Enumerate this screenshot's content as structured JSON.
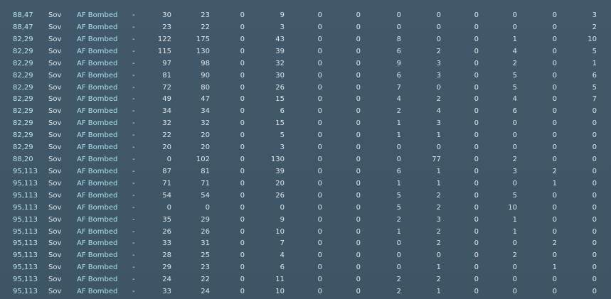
{
  "table": {
    "rows": [
      {
        "coord": "88,47",
        "side": "Sov",
        "type": "AF Bombed",
        "dash": "-",
        "values": [
          "30",
          "23",
          "0",
          "9",
          "0",
          "0",
          "0",
          "0",
          "0",
          "0",
          "0",
          "3"
        ]
      },
      {
        "coord": "88,47",
        "side": "Sov",
        "type": "AF Bombed",
        "dash": "-",
        "values": [
          "23",
          "22",
          "0",
          "3",
          "0",
          "0",
          "0",
          "0",
          "0",
          "0",
          "0",
          "2"
        ]
      },
      {
        "coord": "82,29",
        "side": "Sov",
        "type": "AF Bombed",
        "dash": "-",
        "values": [
          "122",
          "175",
          "0",
          "43",
          "0",
          "0",
          "8",
          "0",
          "0",
          "1",
          "0",
          "10"
        ]
      },
      {
        "coord": "82,29",
        "side": "Sov",
        "type": "AF Bombed",
        "dash": "-",
        "values": [
          "115",
          "130",
          "0",
          "39",
          "0",
          "0",
          "6",
          "2",
          "0",
          "4",
          "0",
          "5"
        ]
      },
      {
        "coord": "82,29",
        "side": "Sov",
        "type": "AF Bombed",
        "dash": "-",
        "values": [
          "97",
          "98",
          "0",
          "32",
          "0",
          "0",
          "9",
          "3",
          "0",
          "2",
          "0",
          "1"
        ]
      },
      {
        "coord": "82,29",
        "side": "Sov",
        "type": "AF Bombed",
        "dash": "-",
        "values": [
          "81",
          "90",
          "0",
          "30",
          "0",
          "0",
          "6",
          "3",
          "0",
          "5",
          "0",
          "6"
        ]
      },
      {
        "coord": "82,29",
        "side": "Sov",
        "type": "AF Bombed",
        "dash": "-",
        "values": [
          "72",
          "80",
          "0",
          "26",
          "0",
          "0",
          "7",
          "0",
          "0",
          "5",
          "0",
          "5"
        ]
      },
      {
        "coord": "82,29",
        "side": "Sov",
        "type": "AF Bombed",
        "dash": "-",
        "values": [
          "49",
          "47",
          "0",
          "15",
          "0",
          "0",
          "4",
          "2",
          "0",
          "4",
          "0",
          "7"
        ]
      },
      {
        "coord": "82,29",
        "side": "Sov",
        "type": "AF Bombed",
        "dash": "-",
        "values": [
          "34",
          "34",
          "0",
          "6",
          "0",
          "0",
          "2",
          "4",
          "0",
          "6",
          "0",
          "0"
        ]
      },
      {
        "coord": "82,29",
        "side": "Sov",
        "type": "AF Bombed",
        "dash": "-",
        "values": [
          "32",
          "32",
          "0",
          "15",
          "0",
          "0",
          "1",
          "3",
          "0",
          "0",
          "0",
          "0"
        ]
      },
      {
        "coord": "82,29",
        "side": "Sov",
        "type": "AF Bombed",
        "dash": "-",
        "values": [
          "22",
          "20",
          "0",
          "5",
          "0",
          "0",
          "1",
          "1",
          "0",
          "0",
          "0",
          "0"
        ]
      },
      {
        "coord": "82,29",
        "side": "Sov",
        "type": "AF Bombed",
        "dash": "-",
        "values": [
          "20",
          "20",
          "0",
          "3",
          "0",
          "0",
          "0",
          "0",
          "0",
          "0",
          "0",
          "0"
        ]
      },
      {
        "coord": "88,20",
        "side": "Sov",
        "type": "AF Bombed",
        "dash": "-",
        "values": [
          "0",
          "102",
          "0",
          "130",
          "0",
          "0",
          "0",
          "77",
          "0",
          "2",
          "0",
          "0"
        ]
      },
      {
        "coord": "95,113",
        "side": "Sov",
        "type": "AF Bombed",
        "dash": "-",
        "values": [
          "87",
          "81",
          "0",
          "39",
          "0",
          "0",
          "6",
          "1",
          "0",
          "3",
          "2",
          "0"
        ]
      },
      {
        "coord": "95,113",
        "side": "Sov",
        "type": "AF Bombed",
        "dash": "-",
        "values": [
          "71",
          "71",
          "0",
          "20",
          "0",
          "0",
          "1",
          "1",
          "0",
          "0",
          "1",
          "0"
        ]
      },
      {
        "coord": "95,113",
        "side": "Sov",
        "type": "AF Bombed",
        "dash": "-",
        "values": [
          "54",
          "54",
          "0",
          "26",
          "0",
          "0",
          "5",
          "2",
          "0",
          "5",
          "0",
          "0"
        ]
      },
      {
        "coord": "95,113",
        "side": "Sov",
        "type": "AF Bombed",
        "dash": "-",
        "values": [
          "0",
          "0",
          "0",
          "0",
          "0",
          "0",
          "5",
          "2",
          "0",
          "10",
          "0",
          "0"
        ]
      },
      {
        "coord": "95,113",
        "side": "Sov",
        "type": "AF Bombed",
        "dash": "-",
        "values": [
          "35",
          "29",
          "0",
          "9",
          "0",
          "0",
          "2",
          "3",
          "0",
          "1",
          "0",
          "0"
        ]
      },
      {
        "coord": "95,113",
        "side": "Sov",
        "type": "AF Bombed",
        "dash": "-",
        "values": [
          "26",
          "26",
          "0",
          "10",
          "0",
          "0",
          "1",
          "2",
          "0",
          "1",
          "0",
          "0"
        ]
      },
      {
        "coord": "95,113",
        "side": "Sov",
        "type": "AF Bombed",
        "dash": "-",
        "values": [
          "33",
          "31",
          "0",
          "7",
          "0",
          "0",
          "0",
          "2",
          "0",
          "0",
          "2",
          "0"
        ]
      },
      {
        "coord": "95,113",
        "side": "Sov",
        "type": "AF Bombed",
        "dash": "-",
        "values": [
          "28",
          "25",
          "0",
          "4",
          "0",
          "0",
          "0",
          "0",
          "0",
          "2",
          "0",
          "0"
        ]
      },
      {
        "coord": "95,113",
        "side": "Sov",
        "type": "AF Bombed",
        "dash": "-",
        "values": [
          "29",
          "23",
          "0",
          "6",
          "0",
          "0",
          "0",
          "1",
          "0",
          "0",
          "1",
          "0"
        ]
      },
      {
        "coord": "95,113",
        "side": "Sov",
        "type": "AF Bombed",
        "dash": "-",
        "values": [
          "24",
          "22",
          "0",
          "11",
          "0",
          "0",
          "2",
          "2",
          "0",
          "0",
          "0",
          "0"
        ]
      },
      {
        "coord": "95,113",
        "side": "Sov",
        "type": "AF Bombed",
        "dash": "-",
        "values": [
          "33",
          "24",
          "0",
          "10",
          "0",
          "0",
          "2",
          "1",
          "0",
          "0",
          "0",
          "0"
        ]
      }
    ]
  }
}
